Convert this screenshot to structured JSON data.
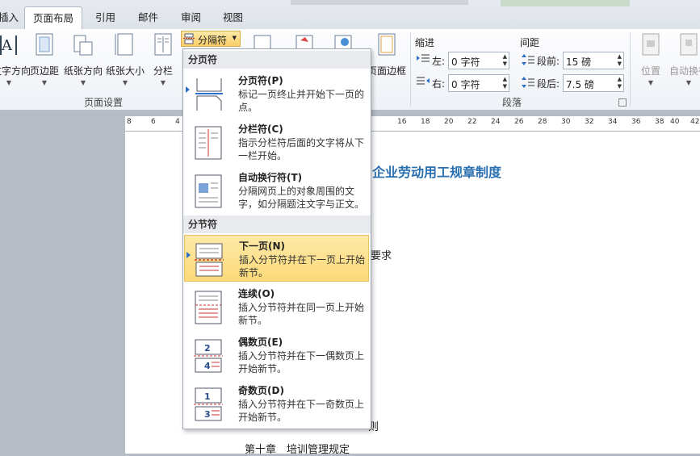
{
  "tabs": [
    "插入",
    "页面布局",
    "引用",
    "邮件",
    "审阅",
    "视图"
  ],
  "ribbon": {
    "page_setup_buttons": [
      "文字方向",
      "页边距",
      "纸张方向",
      "纸张大小",
      "分栏"
    ],
    "page_setup_group": "页面设置",
    "breaks_button": "分隔符",
    "page_border": "页面边框",
    "indent_label": "缩进",
    "indent_left_label": "左:",
    "indent_left_value": "0 字符",
    "indent_right_label": "右:",
    "indent_right_value": "0 字符",
    "spacing_label": "间距",
    "spacing_before_label": "段前:",
    "spacing_before_value": "15 磅",
    "spacing_after_label": "段后:",
    "spacing_after_value": "7.5 磅",
    "paragraph_group": "段落",
    "position_label": "位置",
    "autowrap_label": "自动换行"
  },
  "ruler_ticks": [
    "8",
    "6",
    "4",
    "16",
    "18",
    "20",
    "22",
    "24",
    "26",
    "28",
    "30",
    "32",
    "34",
    "36",
    "38",
    "40",
    "42"
  ],
  "document": {
    "title": "企业劳动用工规章制度",
    "fragment1": "要求",
    "fragment2": "则",
    "chapter_line": "第十章　培训管理规定"
  },
  "dropdown": {
    "page_breaks_header": "分页符",
    "section_breaks_header": "分节符",
    "items": [
      {
        "title": "分页符(P)",
        "desc": "标记一页终止并开始下一页的点。"
      },
      {
        "title": "分栏符(C)",
        "desc": "指示分栏符后面的文字将从下一栏开始。"
      },
      {
        "title": "自动换行符(T)",
        "desc": "分隔网页上的对象周围的文字，如分隔题注文字与正文。"
      },
      {
        "title": "下一页(N)",
        "desc": "插入分节符并在下一页上开始新节。"
      },
      {
        "title": "连续(O)",
        "desc": "插入分节符并在同一页上开始新节。"
      },
      {
        "title": "偶数页(E)",
        "desc": "插入分节符并在下一偶数页上开始新节。"
      },
      {
        "title": "奇数页(D)",
        "desc": "插入分节符并在下一奇数页上开始新节。"
      }
    ]
  }
}
